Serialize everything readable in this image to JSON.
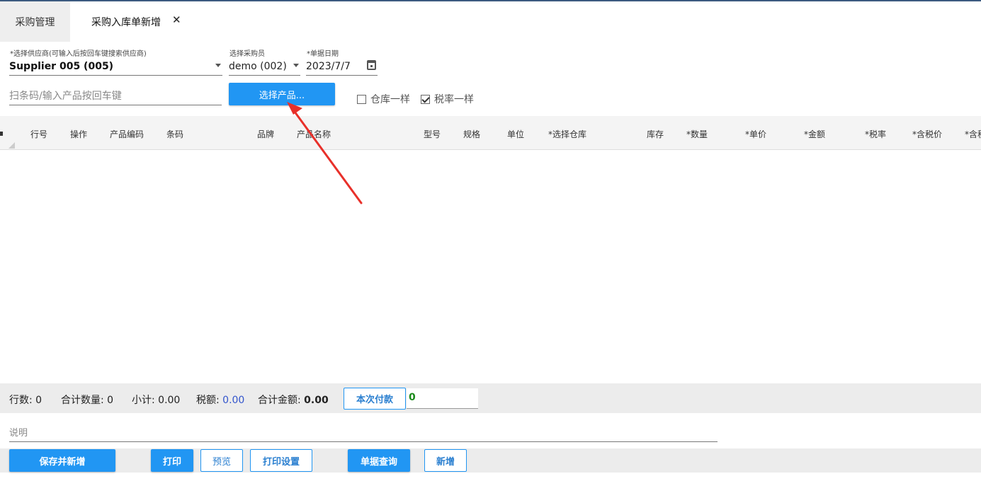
{
  "tabs": {
    "inactive_label": "采购管理",
    "active_label": "采购入库单新增",
    "close_glyph": "✕"
  },
  "form": {
    "supplier": {
      "label": "*选择供应商(可输入后按回车键搜索供应商)",
      "value": "Supplier 005 (005)"
    },
    "buyer": {
      "label": "选择采购员",
      "value": "demo (002)"
    },
    "date": {
      "label": "*单据日期",
      "value": "2023/7/7"
    },
    "barcode": {
      "placeholder": "扫条码/输入产品按回车键"
    },
    "select_product_button": "选择产品...",
    "same_warehouse": {
      "label": "仓库一样",
      "checked": false
    },
    "same_tax": {
      "label": "税率一样",
      "checked": true
    }
  },
  "table": {
    "columns": [
      "行号",
      "操作",
      "产品编码",
      "条码",
      "品牌",
      "产品名称",
      "型号",
      "规格",
      "单位",
      "*选择仓库",
      "库存",
      "*数量",
      "*单价",
      "*金额",
      "*税率",
      "*含税价",
      "*含税"
    ],
    "rows": []
  },
  "summary": {
    "rows_label": "行数:",
    "rows_value": "0",
    "qty_label": "合计数量:",
    "qty_value": "0",
    "subtotal_label": "小计:",
    "subtotal_value": "0.00",
    "tax_label": "税额:",
    "tax_value": "0.00",
    "total_label": "合计金额:",
    "total_value": "0.00",
    "pay_button": "本次付款",
    "pay_value": "0"
  },
  "note": {
    "placeholder": "说明"
  },
  "actions": {
    "save_new": "保存并新增",
    "print": "打印",
    "preview": "预览",
    "print_settings": "打印设置",
    "query": "单据查询",
    "add": "新增"
  },
  "colors": {
    "primary": "#2196f3",
    "annotation_arrow": "#e8302a",
    "tax_value": "#3355cc",
    "pay_value": "#1a8a1a"
  },
  "icons": [
    "close-icon",
    "chevron-down-icon",
    "calendar-icon",
    "checkbox-icon",
    "annotation-arrow"
  ]
}
